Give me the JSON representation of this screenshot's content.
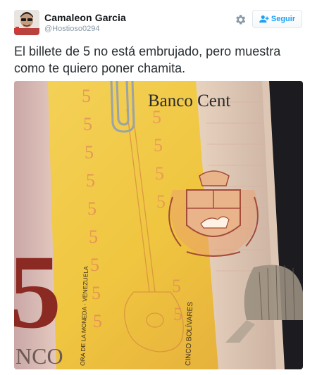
{
  "tweet": {
    "user": {
      "name": "Camaleon Garcia",
      "handle": "@Hostioso0294"
    },
    "follow_button_label": "Seguir",
    "text": "El billete de 5 no está embrujado, pero muestra como te quiero poner chamita.",
    "media": {
      "banknote_text": "Banco Cent",
      "denomination": "5",
      "corner_text": "NCO",
      "vertical_text_1": "ORA DE LA MONEDA · VENEZUELA",
      "vertical_text_2": "CINCO BOLÍVARES"
    }
  },
  "icons": {
    "settings": "gear-icon",
    "follow": "add-user-icon"
  },
  "colors": {
    "accent": "#1da1f2",
    "name": "#14171a",
    "handle": "#8899a6"
  }
}
